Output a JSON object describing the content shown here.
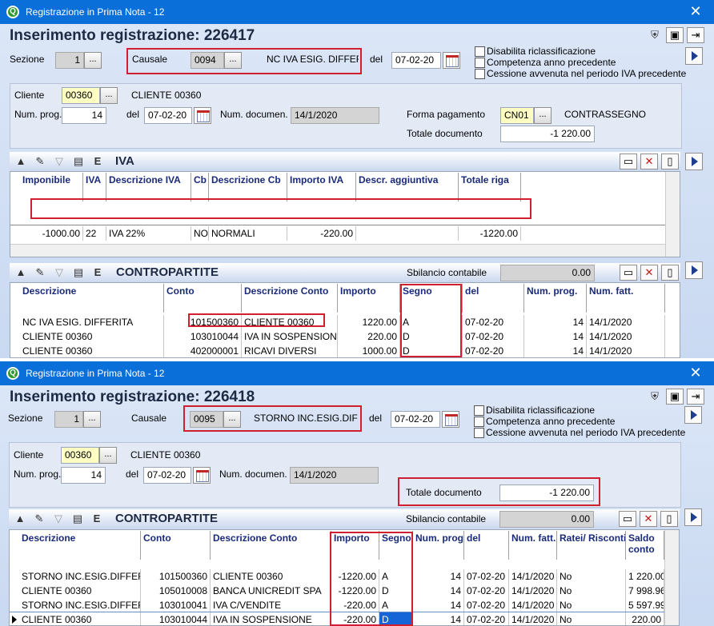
{
  "window1": {
    "title": "Registrazione in Prima Nota - 12",
    "heading": "Inserimento registrazione: 226417",
    "sezione_label": "Sezione",
    "sezione_value": "1",
    "causale_label": "Causale",
    "causale_code": "0094",
    "causale_desc": "NC IVA ESIG. DIFFERITA",
    "del_label": "del",
    "del_value": "07-02-20",
    "checks": [
      "Disabilita riclassificazione",
      "Competenza anno precedente",
      "Cessione avvenuta nel periodo IVA precedente"
    ],
    "cliente_label": "Cliente",
    "cliente_code": "00360",
    "cliente_name": "CLIENTE 00360",
    "numprog_label": "Num. prog.",
    "numprog_value": "14",
    "del2_label": "del",
    "del2_value": "07-02-20",
    "numdoc_label": "Num. documen.",
    "numdoc_value": "14/1/2020",
    "forma_label": "Forma pagamento",
    "forma_code": "CN01",
    "forma_desc": "CONTRASSEGNO",
    "totale_label": "Totale documento",
    "totale_value": "-1 220.00",
    "iva_title": "IVA",
    "iva_headers": [
      "Imponibile",
      "IVA",
      "Descrizione IVA",
      "Cb",
      "Descrizione Cb",
      "Importo IVA",
      "Descr. aggiuntiva",
      "Totale riga"
    ],
    "iva_row": [
      "-1000.00",
      "22",
      "IVA 22%",
      "NO",
      "NORMALI",
      "-220.00",
      "",
      "-1220.00"
    ],
    "contro_title": "CONTROPARTITE",
    "sbilancio_label": "Sbilancio contabile",
    "sbilancio_value": "0.00",
    "contro_headers": [
      "Descrizione",
      "Conto",
      "Descrizione Conto",
      "Importo",
      "Segno",
      "del",
      "Num. prog.",
      "Num. fatt."
    ],
    "contro_rows": [
      [
        "NC IVA ESIG. DIFFERITA",
        "101500360",
        "CLIENTE 00360",
        "1220.00",
        "A",
        "07-02-20",
        "14",
        "14/1/2020"
      ],
      [
        "CLIENTE 00360",
        "103010044",
        "IVA IN SOSPENSIONE",
        "220.00",
        "D",
        "07-02-20",
        "14",
        "14/1/2020"
      ],
      [
        "CLIENTE 00360",
        "402000001",
        "RICAVI DIVERSI",
        "1000.00",
        "D",
        "07-02-20",
        "14",
        "14/1/2020"
      ]
    ]
  },
  "window2": {
    "title": "Registrazione in Prima Nota - 12",
    "heading": "Inserimento registrazione: 226418",
    "sezione_label": "Sezione",
    "sezione_value": "1",
    "causale_label": "Causale",
    "causale_code": "0095",
    "causale_desc": "STORNO INC.ESIG.DIFI",
    "del_label": "del",
    "del_value": "07-02-20",
    "checks": [
      "Disabilita riclassificazione",
      "Competenza anno precedente",
      "Cessione avvenuta nel periodo IVA precedente"
    ],
    "cliente_label": "Cliente",
    "cliente_code": "00360",
    "cliente_name": "CLIENTE 00360",
    "numprog_label": "Num. prog.",
    "numprog_value": "14",
    "del2_label": "del",
    "del2_value": "07-02-20",
    "numdoc_label": "Num. documen.",
    "numdoc_value": "14/1/2020",
    "totale_label": "Totale documento",
    "totale_value": "-1 220.00",
    "contro_title": "CONTROPARTITE",
    "sbilancio_label": "Sbilancio contabile",
    "sbilancio_value": "0.00",
    "contro_headers": [
      "Descrizione",
      "Conto",
      "Descrizione Conto",
      "Importo",
      "Segno",
      "Num. prog.",
      "del",
      "Num. fatt.",
      "Ratei/ Risconti",
      "Saldo conto"
    ],
    "contro_rows": [
      [
        "STORNO INC.ESIG.DIFFER",
        "101500360",
        "CLIENTE 00360",
        "-1220.00",
        "A",
        "14",
        "07-02-20",
        "14/1/2020",
        "No",
        "1 220.00"
      ],
      [
        "CLIENTE 00360",
        "105010008",
        "BANCA UNICREDIT SPA",
        "-1220.00",
        "D",
        "14",
        "07-02-20",
        "14/1/2020",
        "No",
        "7 998.96"
      ],
      [
        "STORNO INC.ESIG.DIFFER",
        "103010041",
        "IVA C/VENDITE",
        "-220.00",
        "A",
        "14",
        "07-02-20",
        "14/1/2020",
        "No",
        "5 597.99"
      ],
      [
        "CLIENTE 00360",
        "103010044",
        "IVA IN SOSPENSIONE",
        "-220.00",
        "D",
        "14",
        "07-02-20",
        "14/1/2020",
        "No",
        "220.00"
      ]
    ]
  }
}
